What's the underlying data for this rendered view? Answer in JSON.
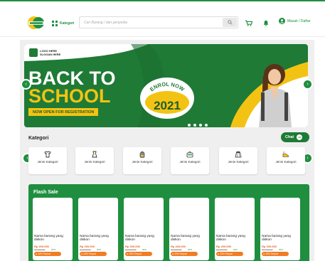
{
  "header": {
    "kategori_label": "Kategori",
    "search_placeholder": "Cari Barang / dan penyedia",
    "account_label": "Masuk / Daftar"
  },
  "banner": {
    "logo_line1": "LOGO HERE",
    "logo_line2": "SLOGAN HERE",
    "title_line1": "BACK TO",
    "title_line2": "SCHOOL",
    "subtitle": "NOW OPEN FOR REGISTRATION",
    "enrol_text": "ENROL NOW",
    "year": "2021",
    "slide_count": 4
  },
  "categories": {
    "title": "Kategori",
    "items": [
      {
        "label": "Jenis Kategori",
        "icon": "shirt-icon"
      },
      {
        "label": "Jenis Kategori",
        "icon": "uniform-icon"
      },
      {
        "label": "Jenis Kategori",
        "icon": "backpack-icon"
      },
      {
        "label": "Jenis Kategori",
        "icon": "lunchbox-icon"
      },
      {
        "label": "Jenis Kategori",
        "icon": "skirt-icon"
      },
      {
        "label": "Jenis Kategori",
        "icon": "shoes-icon"
      }
    ]
  },
  "chat": {
    "label": "Chat"
  },
  "flash_sale": {
    "title": "Flash Sale",
    "products": [
      {
        "name": "Nama barang yang diskon",
        "price": "Rp 200.000",
        "old_price": "Rp 300.000",
        "discount": "30%",
        "sold": "10% Terjual"
      },
      {
        "name": "Nama barang yang diskon",
        "price": "Rp 200.000",
        "old_price": "Rp 300.000",
        "discount": "30%",
        "sold": "10% Terjual"
      },
      {
        "name": "Nama barang yang diskon",
        "price": "Rp 200.000",
        "old_price": "Rp 300.000",
        "discount": "30%",
        "sold": "10% Terjual"
      },
      {
        "name": "Nama barang yang diskon",
        "price": "Rp 200.000",
        "old_price": "Rp 300.000",
        "discount": "30%",
        "sold": "10% Terjual"
      },
      {
        "name": "Nama barang yang diskon",
        "price": "Rp 200.000",
        "old_price": "Rp 300.000",
        "discount": "30%",
        "sold": "10% Terjual"
      },
      {
        "name": "Nama barang yang diskon",
        "price": "Rp 200.000",
        "old_price": "Rp 300.000",
        "discount": "30%",
        "sold": "10% Terjual"
      }
    ]
  },
  "colors": {
    "brand_green": "#1f8f3f",
    "accent_yellow": "#f3c313",
    "sold_orange": "#f07d24"
  }
}
